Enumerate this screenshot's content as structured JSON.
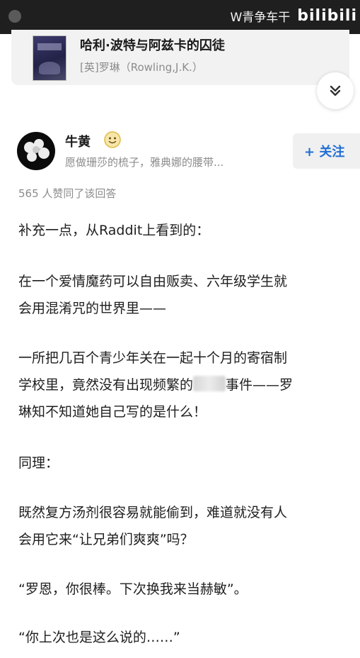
{
  "watermark": {
    "text": "W青争车干",
    "logo": "bilibili"
  },
  "book": {
    "title": "哈利·波特与阿兹卡的囚徒",
    "author": "[英]罗琳（Rowling,J.K.）"
  },
  "collapse": {
    "icon": "chevron-double-down-icon"
  },
  "author_block": {
    "name": "牛黄",
    "badge_icon": "smiley-badge-icon",
    "bio": "愿做珊莎的梳子，雅典娜的腰带...",
    "follow_label": "+ 关注",
    "avatar": "flower-avatar"
  },
  "answer": {
    "likes": "565 人赞同了该回答",
    "lines": [
      "补充一点，从Raddit上看到的：",
      "在一个爱情魔药可以自由贩卖、六年级学生就",
      "会用混淆咒的世界里——",
      "一所把几百个青少年关在一起十个月的寄宿制",
      "学校里，竟然没有出现频繁的",
      "事件——罗",
      "琳知不知道她自己写的是什么！",
      "同理：",
      "既然复方汤剂很容易就能偷到，难道就没有人",
      "会用它来“让兄弟们爽爽”吗？",
      "“罗恩，你很棒。下次换我来当赫敏”。",
      "“你上次也是这么说的……”"
    ]
  },
  "colors": {
    "accent": "#1f6ed4",
    "muted_text": "#8c8c8c",
    "card_bg": "#f2f2f2"
  }
}
